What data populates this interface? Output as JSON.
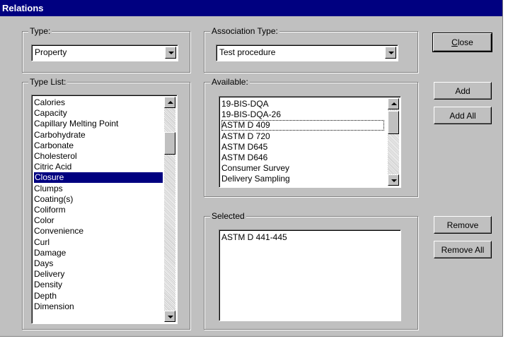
{
  "window": {
    "title": "Relations"
  },
  "type_group": {
    "label": "Type:",
    "value": "Property"
  },
  "type_list": {
    "label": "Type List:",
    "items": [
      "Calories",
      "Capacity",
      "Capillary Melting Point",
      "Carbohydrate",
      "Carbonate",
      "Cholesterol",
      "Citric Acid",
      "Closure",
      "Clumps",
      "Coating(s)",
      "Coliform",
      "Color",
      "Convenience",
      "Curl",
      "Damage",
      "Days",
      "Delivery",
      "Density",
      "Depth",
      "Dimension"
    ],
    "selected": "Closure"
  },
  "association_group": {
    "label": "Association Type:",
    "value": "Test procedure"
  },
  "available": {
    "label": "Available:",
    "items": [
      "19-BIS-DQA",
      "19-BIS-DQA-26",
      "ASTM D 409",
      "ASTM D 720",
      "ASTM D645",
      "ASTM D646",
      "Consumer Survey",
      "Delivery Sampling"
    ],
    "focused": "ASTM D 409"
  },
  "selected": {
    "label": "Selected",
    "items": [
      "ASTM D 441-445"
    ]
  },
  "buttons": {
    "close": "Close",
    "add": "Add",
    "add_all": "Add All",
    "remove": "Remove",
    "remove_all": "Remove All"
  },
  "colors": {
    "face": "#c0c0c0",
    "title_bar": "#000080",
    "selection": "#000080"
  },
  "icons": {
    "scroll_up": "triangle-up-icon",
    "scroll_down": "triangle-down-icon",
    "dropdown": "triangle-down-icon"
  }
}
